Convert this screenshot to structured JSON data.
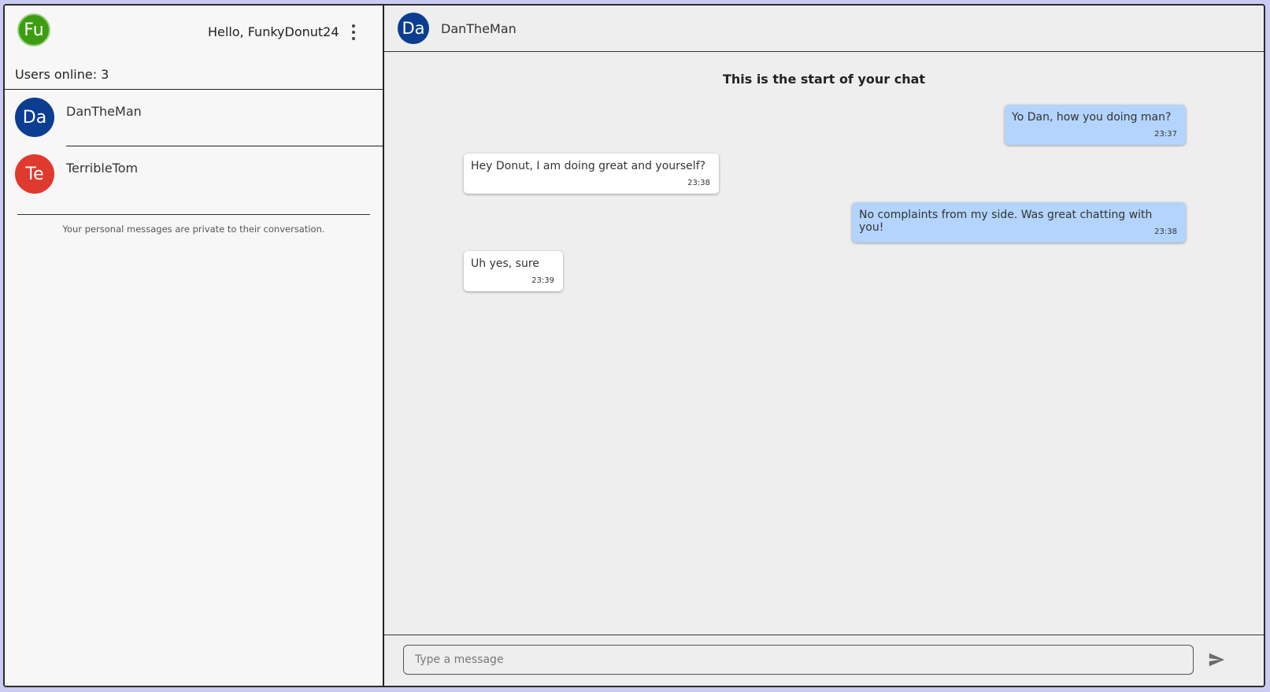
{
  "sidebar": {
    "me": {
      "initials": "Fu",
      "color": "#3c9d10"
    },
    "greeting": "Hello, FunkyDonut24",
    "menu_icon": "more-vert-icon",
    "users_online": "Users online: 3",
    "users": [
      {
        "initials": "Da",
        "name": "DanTheMan",
        "color": "#0b3d91"
      },
      {
        "initials": "Te",
        "name": "TerribleTom",
        "color": "#e0392e"
      }
    ],
    "privacy_note": "Your personal messages are private to their conversation."
  },
  "chat": {
    "header": {
      "initials": "Da",
      "name": "DanTheMan"
    },
    "start_text": "This is the start of your chat",
    "messages": [
      {
        "from": "me",
        "text": "Yo Dan, how you doing man?",
        "time": "23:37"
      },
      {
        "from": "them",
        "text": "Hey Donut, I am doing great and yourself?",
        "time": "23:38"
      },
      {
        "from": "me",
        "text": "No complaints from my side. Was great chatting with you!",
        "time": "23:38"
      },
      {
        "from": "them",
        "text": "Uh yes, sure",
        "time": "23:39"
      }
    ],
    "composer": {
      "placeholder": "Type a message",
      "value": "",
      "send_icon": "send-icon"
    }
  },
  "colors": {
    "my_bubble": "#b3d4fc",
    "their_bubble": "#ffffff",
    "background": "#eeeeee"
  }
}
